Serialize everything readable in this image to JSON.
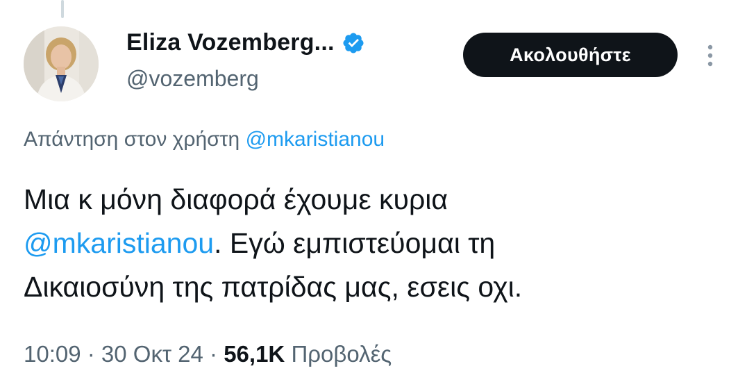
{
  "author": {
    "display_name": "Eliza Vozemberg...",
    "handle": "@vozemberg",
    "verified": true,
    "avatar_icon": "profile-photo",
    "verified_icon": "verified-badge-icon",
    "verified_color": "#1d9bf0"
  },
  "actions": {
    "follow_label": "Ακολουθήστε",
    "more_icon": "more-vertical-icon"
  },
  "reply": {
    "prefix": "Απάντηση στον χρήστη",
    "mention": "@mkaristianou"
  },
  "tweet": {
    "line1": "Μια κ μόνη διαφορά έχουμε κυρια",
    "line2_mention": "@mkaristianou",
    "line2_rest": ". Εγώ εμπιστεύομαι τη",
    "line3": "Δικαιοσύνη της πατρίδας μας, εσεις οχι."
  },
  "meta": {
    "time": "10:09",
    "separator": " · ",
    "date": "30 Οκτ 24",
    "views_count": "56,1K",
    "views_label": "Προβολές"
  },
  "colors": {
    "text": "#0f1419",
    "secondary": "#536471",
    "link": "#1d9bf0",
    "button_bg": "#0f1419"
  }
}
